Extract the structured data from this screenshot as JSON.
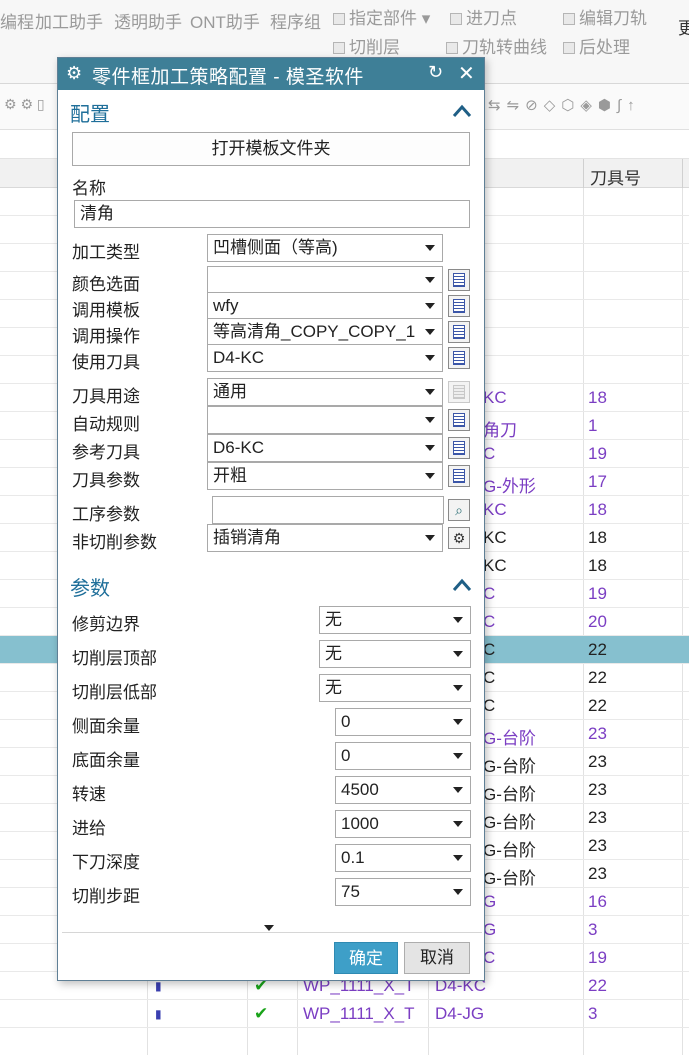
{
  "ribbon": {
    "row1": [
      "编程",
      "加工助手",
      "透明助手",
      "ONT助手",
      "程序组",
      "指定部件",
      "进刀点",
      "编辑刀轨",
      "更"
    ],
    "row2": [
      "切削层",
      "刀轨转曲线",
      "后处理"
    ]
  },
  "grid": {
    "header_tool": "刀具号",
    "rows": [
      {
        "tool": "KC",
        "num": "18",
        "sel": false,
        "num_color": "purple",
        "tool_color": "purple"
      },
      {
        "tool": "角刀",
        "num": "1",
        "sel": false,
        "num_color": "purple",
        "tool_color": "purple"
      },
      {
        "tool": "C",
        "num": "19",
        "sel": false,
        "num_color": "purple",
        "tool_color": "purple"
      },
      {
        "tool": "G-外形",
        "num": "17",
        "sel": false,
        "num_color": "purple",
        "tool_color": "purple"
      },
      {
        "tool": "KC",
        "num": "18",
        "sel": false,
        "num_color": "purple",
        "tool_color": "purple"
      },
      {
        "tool": "KC",
        "num": "18",
        "sel": false,
        "num_color": "black",
        "tool_color": "black"
      },
      {
        "tool": "KC",
        "num": "18",
        "sel": false,
        "num_color": "black",
        "tool_color": "black"
      },
      {
        "tool": "C",
        "num": "19",
        "sel": false,
        "num_color": "purple",
        "tool_color": "purple"
      },
      {
        "tool": "C",
        "num": "20",
        "sel": false,
        "num_color": "purple",
        "tool_color": "purple"
      },
      {
        "tool": "C",
        "num": "22",
        "sel": true,
        "num_color": "black",
        "tool_color": "black"
      },
      {
        "tool": "C",
        "num": "22",
        "sel": false,
        "num_color": "black",
        "tool_color": "black"
      },
      {
        "tool": "C",
        "num": "22",
        "sel": false,
        "num_color": "black",
        "tool_color": "black"
      },
      {
        "tool": "G-台阶",
        "num": "23",
        "sel": false,
        "num_color": "purple",
        "tool_color": "purple"
      },
      {
        "tool": "G-台阶",
        "num": "23",
        "sel": false,
        "num_color": "black",
        "tool_color": "black"
      },
      {
        "tool": "G-台阶",
        "num": "23",
        "sel": false,
        "num_color": "black",
        "tool_color": "black"
      },
      {
        "tool": "G-台阶",
        "num": "23",
        "sel": false,
        "num_color": "black",
        "tool_color": "black"
      },
      {
        "tool": "G-台阶",
        "num": "23",
        "sel": false,
        "num_color": "black",
        "tool_color": "black"
      },
      {
        "tool": "G-台阶",
        "num": "23",
        "sel": false,
        "num_color": "black",
        "tool_color": "black"
      },
      {
        "tool": "G",
        "num": "16",
        "sel": false,
        "num_color": "purple",
        "tool_color": "purple"
      },
      {
        "tool": "G",
        "num": "3",
        "sel": false,
        "num_color": "purple",
        "tool_color": "purple"
      },
      {
        "tool": "C",
        "num": "19",
        "sel": false,
        "num_color": "purple",
        "tool_color": "purple"
      },
      {
        "tool": "D4-KC",
        "num": "22",
        "sel": false,
        "num_color": "purple",
        "tool_color": "purple",
        "name": "WP_1111_X_T"
      },
      {
        "tool": "D4-JG",
        "num": "3",
        "sel": false,
        "num_color": "purple",
        "tool_color": "purple",
        "name": "WP_1111_X_T"
      }
    ]
  },
  "dialog": {
    "title": "零件框加工策略配置 - 模圣软件",
    "config": {
      "heading": "配置",
      "open_folder_label": "打开模板文件夹",
      "name_label": "名称",
      "name_value": "清角",
      "fields": [
        {
          "label": "加工类型",
          "value": "凹槽侧面（等高)",
          "button": "none"
        },
        {
          "label": "颜色选面",
          "value": "",
          "button": "list"
        },
        {
          "label": "调用模板",
          "value": "wfy",
          "button": "list"
        },
        {
          "label": "调用操作",
          "value": "等高清角_COPY_COPY_1",
          "button": "list"
        },
        {
          "label": "使用刀具",
          "value": "D4-KC",
          "button": "list"
        },
        {
          "label": "刀具用途",
          "value": "通用",
          "button": "list-disabled"
        },
        {
          "label": "自动规则",
          "value": "",
          "button": "list"
        },
        {
          "label": "参考刀具",
          "value": "D6-KC",
          "button": "list"
        },
        {
          "label": "刀具参数",
          "value": "开粗",
          "button": "list"
        },
        {
          "label": "工序参数",
          "value": "",
          "button": "search"
        },
        {
          "label": "非切削参数",
          "value": "插销清角",
          "button": "gear"
        }
      ]
    },
    "params": {
      "heading": "参数",
      "fields": [
        {
          "label": "修剪边界",
          "value": "无"
        },
        {
          "label": "切削层顶部",
          "value": "无"
        },
        {
          "label": "切削层低部",
          "value": "无"
        },
        {
          "label": "侧面余量",
          "value": "0"
        },
        {
          "label": "底面余量",
          "value": "0"
        },
        {
          "label": "转速",
          "value": "4500"
        },
        {
          "label": "进给",
          "value": "1000"
        },
        {
          "label": "下刀深度",
          "value": "0.1"
        },
        {
          "label": "切削步距",
          "value": "75"
        }
      ]
    },
    "ok_label": "确定",
    "cancel_label": "取消"
  }
}
